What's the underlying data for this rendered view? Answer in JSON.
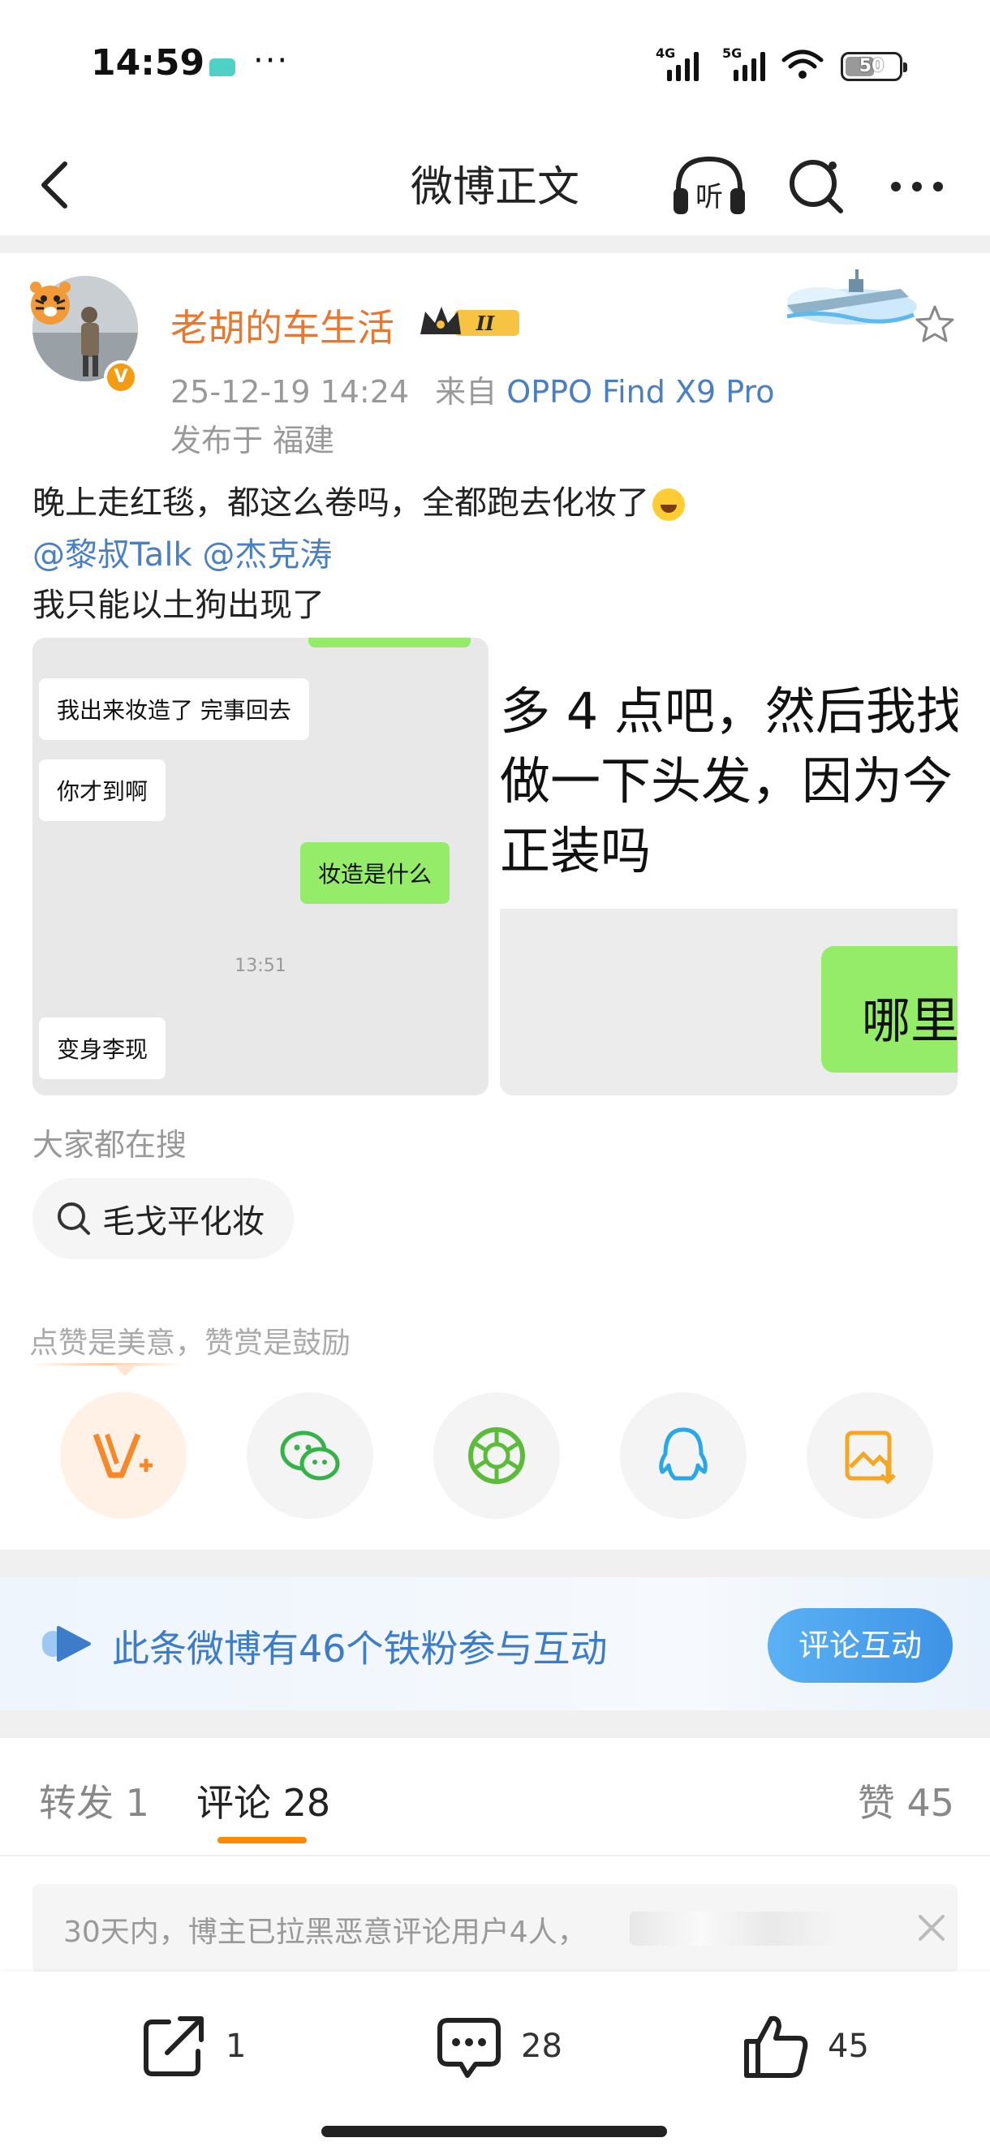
{
  "status_bar": {
    "time": "14:59",
    "dots": "···",
    "net1": "4G",
    "net2": "5G",
    "battery": "50"
  },
  "nav": {
    "title": "微博正文",
    "listen_label": "听"
  },
  "post": {
    "author": "老胡的车生活",
    "level_badge": "II",
    "timestamp": "25-12-19 14:24",
    "source_prefix": "来自",
    "device": "OPPO Find X9 Pro",
    "location": "发布于 福建",
    "text_line1": "晚上走红毯，都这么卷吗，全都跑去化妆了",
    "mention1": "@黎叔Talk",
    "mention2": "@杰克涛",
    "text_line3": "我只能以土狗出现了"
  },
  "image1": {
    "bubble1": "我出来妆造了 完事回去",
    "bubble2": "你才到啊",
    "bubble3": "妆造是什么",
    "time": "13:51",
    "bubble4": "变身李现"
  },
  "image2": {
    "line1": "多 4 点吧，然后我找",
    "line2": "做一下头发，因为今",
    "line3": "正装吗",
    "green_text": "哪里"
  },
  "search": {
    "heading": "大家都在搜",
    "chip": "毛戈平化妆"
  },
  "reward": {
    "label": "点赞是美意，赞赏是鼓励"
  },
  "fans_banner": {
    "text": "此条微博有46个铁粉参与互动",
    "button": "评论互动"
  },
  "tabs": {
    "repost": "转发 1",
    "comments": "评论 28",
    "likes": "赞 45"
  },
  "notice": {
    "text": "30天内，博主已拉黑恶意评论用户4人，"
  },
  "bottom_bar": {
    "repost_count": "1",
    "comment_count": "28",
    "like_count": "45"
  },
  "colors": {
    "author_orange": "#e8782f",
    "link_blue": "#4a7fc2",
    "tab_underline": "#ff8a00",
    "banner_blue": "#3d7cc9"
  }
}
